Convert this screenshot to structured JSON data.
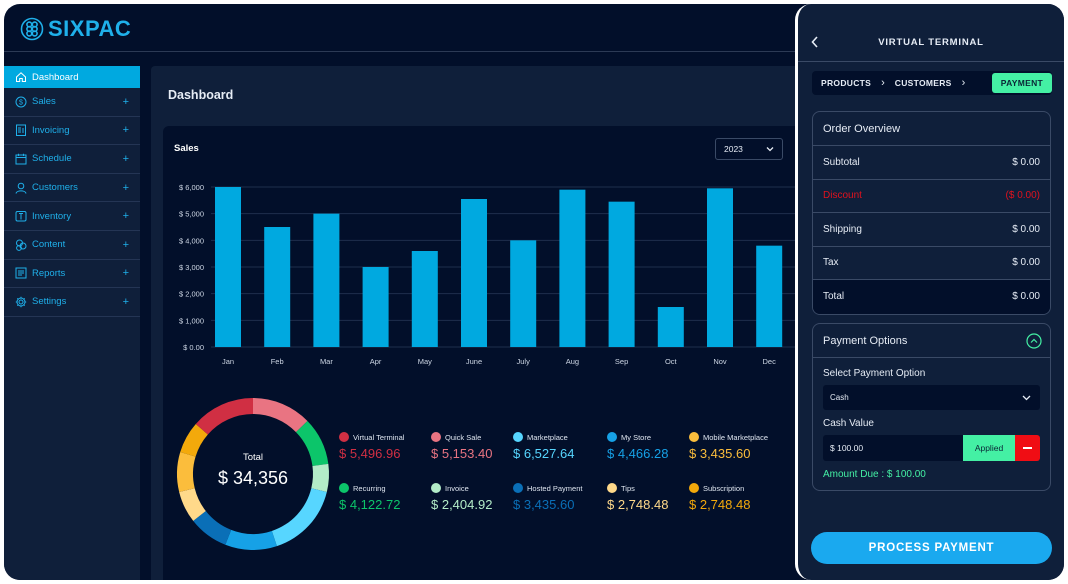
{
  "app": {
    "brand": "SIXPAC"
  },
  "sidebar": {
    "items": [
      {
        "label": "Dashboard",
        "icon": "home-icon",
        "active": true
      },
      {
        "label": "Sales",
        "icon": "dollar-circle-icon",
        "expand": "+"
      },
      {
        "label": "Invoicing",
        "icon": "invoice-icon",
        "expand": "+"
      },
      {
        "label": "Schedule",
        "icon": "calendar-icon",
        "expand": "+"
      },
      {
        "label": "Customers",
        "icon": "user-icon",
        "expand": "+"
      },
      {
        "label": "Inventory",
        "icon": "box-icon",
        "expand": "+"
      },
      {
        "label": "Content",
        "icon": "content-icon",
        "expand": "+"
      },
      {
        "label": "Reports",
        "icon": "report-icon",
        "expand": "+"
      },
      {
        "label": "Settings",
        "icon": "gear-icon",
        "expand": "+"
      }
    ]
  },
  "main": {
    "title": "Dashboard",
    "sales_card": {
      "title": "Sales",
      "year": "2023"
    },
    "donut": {
      "total_label": "Total",
      "total_value": "$ 34,356"
    },
    "legend": [
      {
        "label": "Virtual Terminal",
        "value": "$ 5,496.96",
        "color": "#d02f43",
        "amount": 5496.96
      },
      {
        "label": "Quick Sale",
        "value": "$ 5,153.40",
        "color": "#e97482",
        "amount": 5153.4
      },
      {
        "label": "Marketplace",
        "value": "$ 6,527.64",
        "color": "#57d6ff",
        "amount": 6527.64
      },
      {
        "label": "My Store",
        "value": "$ 4,466.28",
        "color": "#16a1e6",
        "amount": 4466.28
      },
      {
        "label": "Mobile Marketplace",
        "value": "$ 3,435.60",
        "color": "#fbbd3c",
        "amount": 3435.6
      },
      {
        "label": "Recurring",
        "value": "$ 4,122.72",
        "color": "#0cc56a",
        "amount": 4122.72
      },
      {
        "label": "Invoice",
        "value": "$ 2,404.92",
        "color": "#b3ecc8",
        "amount": 2404.92
      },
      {
        "label": "Hosted Payment",
        "value": "$ 3,435.60",
        "color": "#0a6fb7",
        "amount": 3435.6
      },
      {
        "label": "Tips",
        "value": "$ 2,748.48",
        "color": "#ffd98a",
        "amount": 2748.48
      },
      {
        "label": "Subscription",
        "value": "$ 2,748.48",
        "color": "#f3a90b",
        "amount": 2748.48
      }
    ],
    "donut_order": [
      1,
      5,
      6,
      2,
      3,
      7,
      8,
      4,
      9,
      0
    ]
  },
  "chart_data": {
    "type": "bar",
    "title": "Sales",
    "xlabel": "",
    "ylabel": "",
    "categories": [
      "Jan",
      "Feb",
      "Mar",
      "Apr",
      "May",
      "June",
      "July",
      "Aug",
      "Sep",
      "Oct",
      "Nov",
      "Dec"
    ],
    "values": [
      6000,
      4500,
      5000,
      3000,
      3600,
      5550,
      4000,
      5900,
      5450,
      1500,
      5950,
      3800
    ],
    "ylim": [
      0,
      6000
    ],
    "yticks": [
      0,
      1000,
      2000,
      3000,
      4000,
      5000,
      6000
    ],
    "ytick_labels": [
      "$ 0.00",
      "$ 1,000",
      "$ 2,000",
      "$ 3,000",
      "$ 4,000",
      "$ 5,000",
      "$ 6,000"
    ],
    "grid": true,
    "bar_color": "#00a9e0"
  },
  "virtual_terminal": {
    "title": "VIRTUAL TERMINAL",
    "steps": [
      "PRODUCTS",
      "CUSTOMERS",
      "PAYMENT"
    ],
    "active_step": "PAYMENT",
    "order_overview": {
      "title": "Order Overview",
      "rows": [
        {
          "label": "Subtotal",
          "value": "$ 0.00"
        },
        {
          "label": "Discount",
          "value": "($ 0.00)"
        },
        {
          "label": "Shipping",
          "value": "$ 0.00"
        },
        {
          "label": "Tax",
          "value": "$ 0.00"
        },
        {
          "label": "Total",
          "value": "$ 0.00"
        }
      ]
    },
    "payment_options": {
      "title": "Payment Options",
      "select_label": "Select Payment Option",
      "selected_option": "Cash",
      "cash_label": "Cash Value",
      "cash_value": "$ 100.00",
      "applied_label": "Applied",
      "amount_due": "Amount Due : $ 100.00"
    },
    "process_button": "PROCESS PAYMENT"
  }
}
